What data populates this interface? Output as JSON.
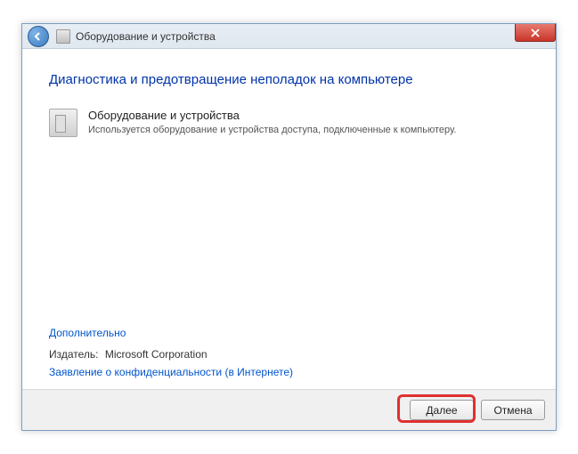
{
  "titlebar": {
    "title": "Оборудование и устройства"
  },
  "content": {
    "heading": "Диагностика и предотвращение неполадок на компьютере",
    "item": {
      "title": "Оборудование и устройства",
      "description": "Используется оборудование и устройства доступа, подключенные к компьютеру."
    },
    "advanced_link": "Дополнительно",
    "publisher_label": "Издатель:",
    "publisher_value": "Microsoft Corporation",
    "privacy_link": "Заявление о конфиденциальности (в Интернете)"
  },
  "footer": {
    "next": "Далее",
    "cancel": "Отмена"
  }
}
